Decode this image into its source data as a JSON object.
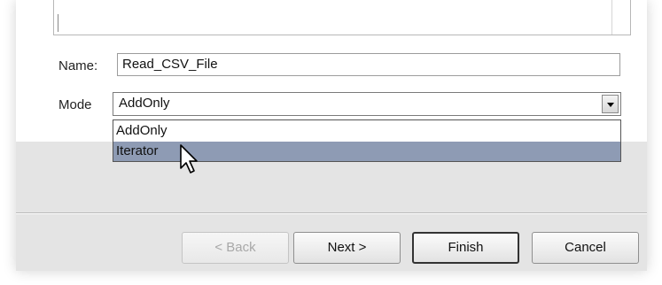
{
  "form": {
    "name_label": "Name:",
    "name_value": "Read_CSV_File",
    "mode_label": "Mode",
    "mode_value": "AddOnly"
  },
  "dropdown": {
    "options": [
      "AddOnly",
      "Iterator"
    ],
    "highlighted": "Iterator"
  },
  "buttons": {
    "back": "< Back",
    "next": "Next >",
    "finish": "Finish",
    "cancel": "Cancel"
  },
  "colors": {
    "highlight": "#8e9bb4",
    "footer_bg": "#e4e4e4"
  },
  "icons": {
    "cursor": "arrow-pointer-icon",
    "dropdown_arrow": "chevron-down-icon"
  }
}
